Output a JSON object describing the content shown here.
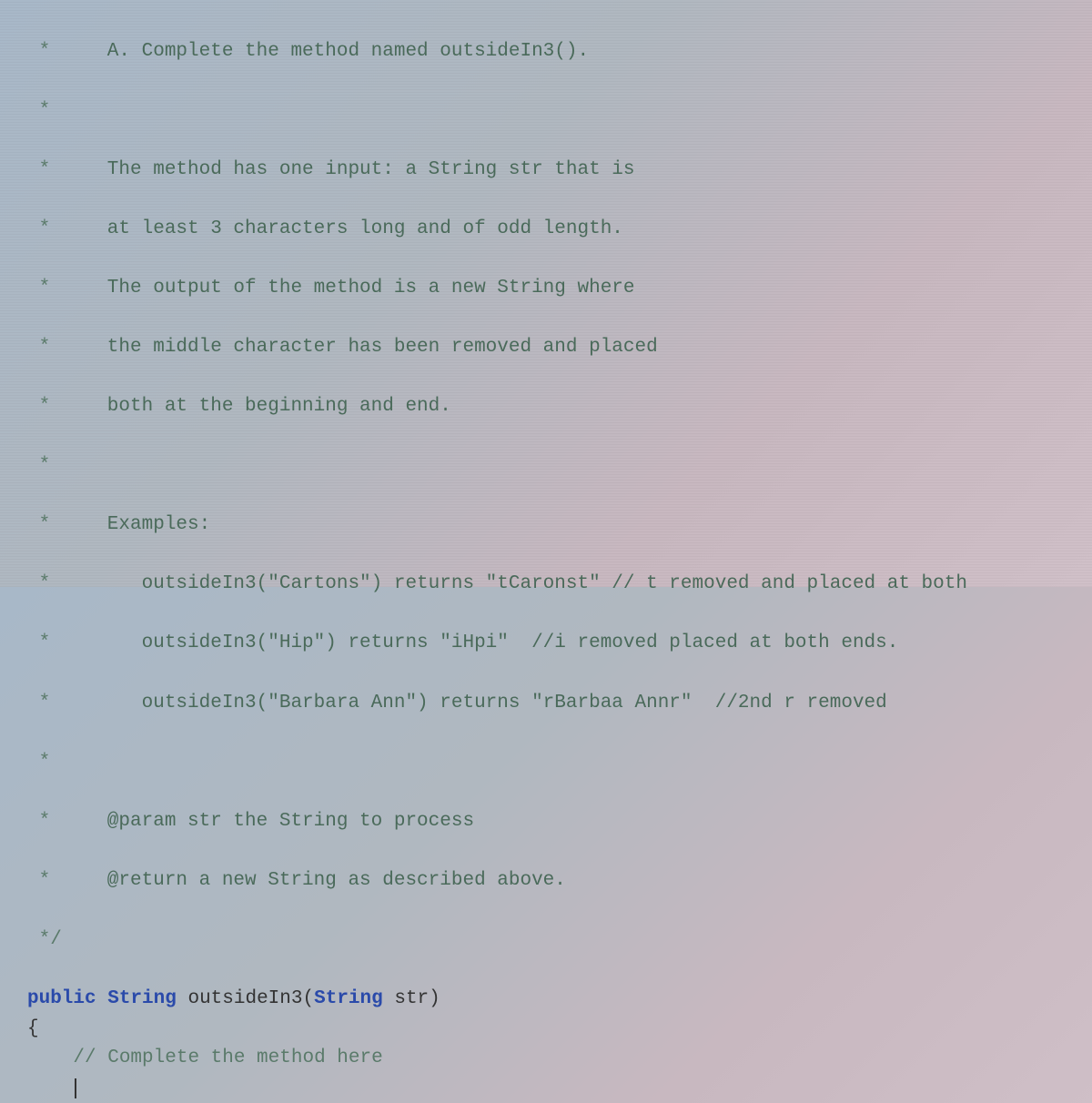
{
  "code": {
    "lines": [
      {
        "star": " *",
        "text": "   A. Complete the method named outsideIn3()."
      },
      {
        "star": " *",
        "text": ""
      },
      {
        "star": " *",
        "text": "   The method has one input: a String str that is"
      },
      {
        "star": " *",
        "text": "   at least 3 characters long and of odd length."
      },
      {
        "star": " *",
        "text": "   The output of the method is a new String where"
      },
      {
        "star": " *",
        "text": "   the middle character has been removed and placed"
      },
      {
        "star": " *",
        "text": "   both at the beginning and end."
      },
      {
        "star": " *",
        "text": ""
      },
      {
        "star": " *",
        "text": "   Examples:"
      },
      {
        "star": " *",
        "text": "      outsideIn3(\"Cartons\") returns \"tCaronst\" // t removed and placed at both"
      },
      {
        "star": " *",
        "text": "      outsideIn3(\"Hip\") returns \"iHpi\"  //i removed placed at both ends."
      },
      {
        "star": " *",
        "text": "      outsideIn3(\"Barbara Ann\") returns \"rBarbaa Annr\"  //2nd r removed"
      },
      {
        "star": " *",
        "text": ""
      },
      {
        "star": " *",
        "text": "   @param str the String to process"
      },
      {
        "star": " *",
        "text": "   @return a new String as described above."
      },
      {
        "star": " */",
        "text": ""
      }
    ],
    "signature": {
      "modifier": "public",
      "return_type": "String",
      "method_name": "outsideIn3",
      "param_type": "String",
      "param_name": "str"
    },
    "open_brace": "{",
    "body_comment": "// Complete the method here"
  }
}
